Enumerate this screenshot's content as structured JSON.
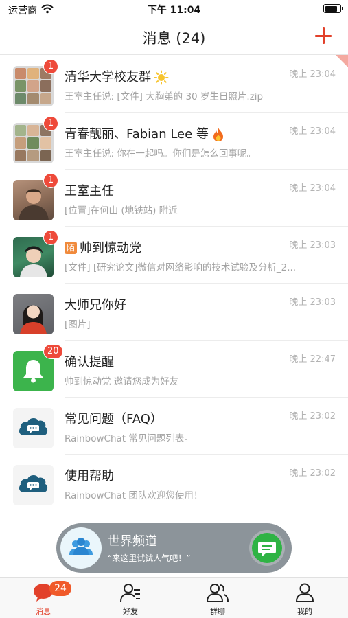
{
  "status_bar": {
    "carrier": "运营商",
    "time": "下午 11:04",
    "battery_level": 0.85
  },
  "nav": {
    "title": "消息 (24)",
    "add_icon": "plus-icon",
    "accent_color": "#e2412b"
  },
  "conversations": [
    {
      "name": "清华大学校友群",
      "emoji": "sun",
      "time": "晚上 23:04",
      "preview": "王室主任说: [文件] 大胸弟的 30 岁生日照片.zip",
      "badge": "1",
      "avatar": "group-grid"
    },
    {
      "name": "青春靓丽、Fabian Lee 等",
      "emoji": "fire",
      "time": "晚上 23:04",
      "preview": "王室主任说: 你在一起吗。你们是怎么回事呢。",
      "badge": "1",
      "avatar": "group-grid"
    },
    {
      "name": "王室主任",
      "time": "晚上 23:04",
      "preview": "[位置]在何山 (地铁站) 附近",
      "badge": "1",
      "avatar": "man-photo"
    },
    {
      "name": "帅到惊动党",
      "tag": "陌",
      "time": "晚上 23:03",
      "preview": "[文件] [研究论文]微信对网络影响的技术试验及分析_2...",
      "badge": "1",
      "avatar": "young-man-photo"
    },
    {
      "name": "大师兄你好",
      "time": "晚上 23:03",
      "preview": "[图片]",
      "avatar": "woman-photo"
    },
    {
      "name": "确认提醒",
      "time": "晚上 22:47",
      "preview": "帅到惊动党 邀请您成为好友",
      "badge": "20",
      "avatar": "bell-icon"
    },
    {
      "name": "常见问题（FAQ）",
      "time": "晚上 23:02",
      "preview": "RainbowChat 常见问题列表。",
      "avatar": "cloud-chat-icon"
    },
    {
      "name": "使用帮助",
      "time": "晚上 23:02",
      "preview": "RainbowChat 团队欢迎您使用！",
      "avatar": "cloud-chat-icon"
    }
  ],
  "world_channel": {
    "title": "世界频道",
    "subtitle": "“来这里试试人气吧！”",
    "icon": "users-icon",
    "action_icon": "chat-bubble-icon"
  },
  "tabbar": {
    "tabs": [
      {
        "label": "消息",
        "icon": "message-icon",
        "badge": "24",
        "active": true
      },
      {
        "label": "好友",
        "icon": "friends-icon"
      },
      {
        "label": "群聊",
        "icon": "group-icon"
      },
      {
        "label": "我的",
        "icon": "profile-icon"
      }
    ]
  }
}
